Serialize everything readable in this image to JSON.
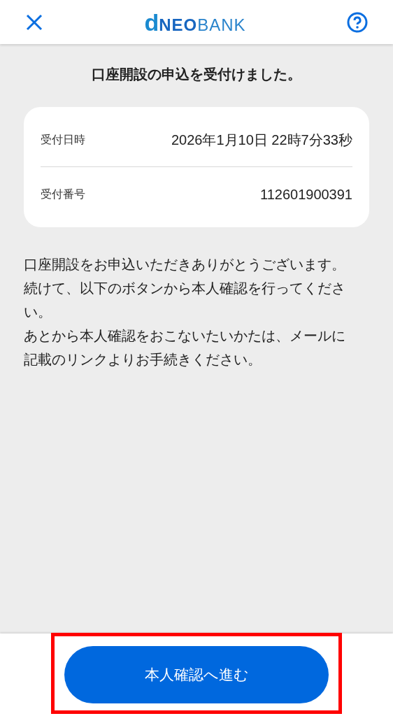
{
  "header": {
    "logo": {
      "mark": "d",
      "bold": "NEO",
      "light": "BANK"
    }
  },
  "title": "口座開設の申込を受付けました。",
  "details": [
    {
      "label": "受付日時",
      "value": "2026年1月10日 22時7分33秒"
    },
    {
      "label": "受付番号",
      "value": "112601900391"
    }
  ],
  "message": [
    "口座開設をお申込いただきありがとうございます。",
    "続けて、以下のボタンから本人確認を行ってください。",
    "あとから本人確認をおこないたいかたは、メールに記載のリンクよりお手続きください。"
  ],
  "button": "本人確認へ進む",
  "annotation": {
    "kind": "frame",
    "color": "#ff0000"
  }
}
